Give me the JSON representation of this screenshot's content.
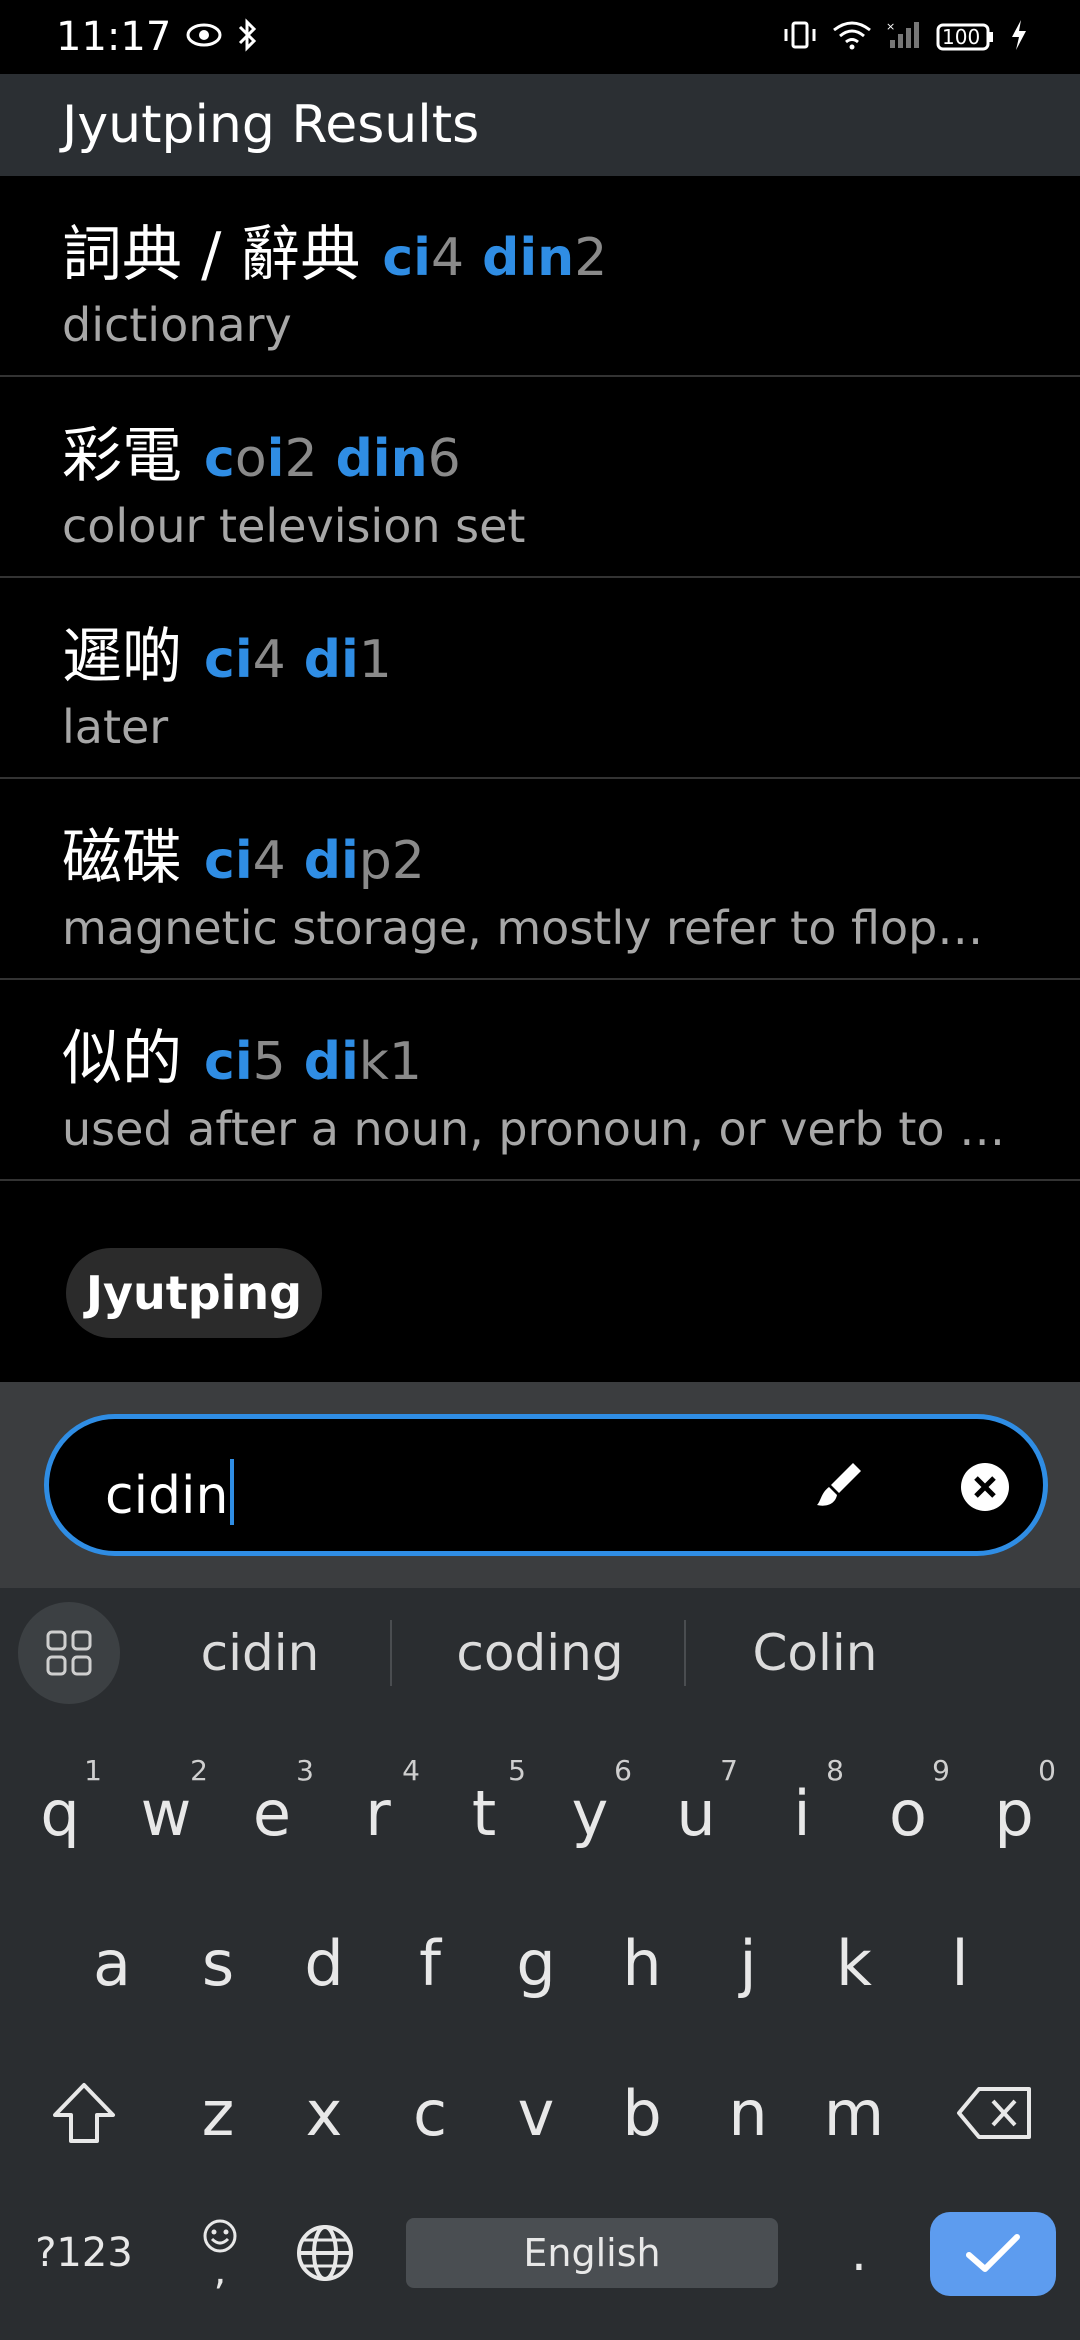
{
  "status_bar": {
    "time": "11:17",
    "battery": "100"
  },
  "app_bar": {
    "title": "Jyutping Results"
  },
  "results": [
    {
      "hanzi": "詞典 / 辭典",
      "jyutping": [
        {
          "hl": "ci",
          "rest": "4"
        },
        {
          "hl": "din",
          "rest": "2"
        }
      ],
      "definition": "dictionary"
    },
    {
      "hanzi": "彩電",
      "jyutping": [
        {
          "hl": "c",
          "mid": "o",
          "hl2": "i",
          "rest": "2"
        },
        {
          "hl": "din",
          "rest": "6"
        }
      ],
      "definition": "colour television set"
    },
    {
      "hanzi": "遲啲",
      "jyutping": [
        {
          "hl": "ci",
          "rest": "4"
        },
        {
          "hl": "di",
          "rest": "1"
        }
      ],
      "definition": "later"
    },
    {
      "hanzi": "磁碟",
      "jyutping": [
        {
          "hl": "ci",
          "rest": "4"
        },
        {
          "hl": "di",
          "rest": "p2"
        }
      ],
      "definition": "magnetic storage, mostly refer to flop…"
    },
    {
      "hanzi": "似的",
      "jyutping": [
        {
          "hl": "ci",
          "rest": "5"
        },
        {
          "hl": "di",
          "rest": "k1"
        }
      ],
      "definition": "used after a noun, pronoun, or verb to …"
    }
  ],
  "chip": {
    "label": "Jyutping"
  },
  "search": {
    "value": "cidin"
  },
  "suggestions": [
    "cidin",
    "coding",
    "Colin"
  ],
  "keyboard": {
    "row1": [
      {
        "k": "q",
        "n": "1"
      },
      {
        "k": "w",
        "n": "2"
      },
      {
        "k": "e",
        "n": "3"
      },
      {
        "k": "r",
        "n": "4"
      },
      {
        "k": "t",
        "n": "5"
      },
      {
        "k": "y",
        "n": "6"
      },
      {
        "k": "u",
        "n": "7"
      },
      {
        "k": "i",
        "n": "8"
      },
      {
        "k": "o",
        "n": "9"
      },
      {
        "k": "p",
        "n": "0"
      }
    ],
    "row2": [
      "a",
      "s",
      "d",
      "f",
      "g",
      "h",
      "j",
      "k",
      "l"
    ],
    "row3": [
      "z",
      "x",
      "c",
      "v",
      "b",
      "n",
      "m"
    ],
    "symbols_label": "?123",
    "emoji_comma": ",",
    "space_label": "English",
    "period": "."
  },
  "colors": {
    "accent": "#2f8de4",
    "enter": "#5d9cef"
  }
}
